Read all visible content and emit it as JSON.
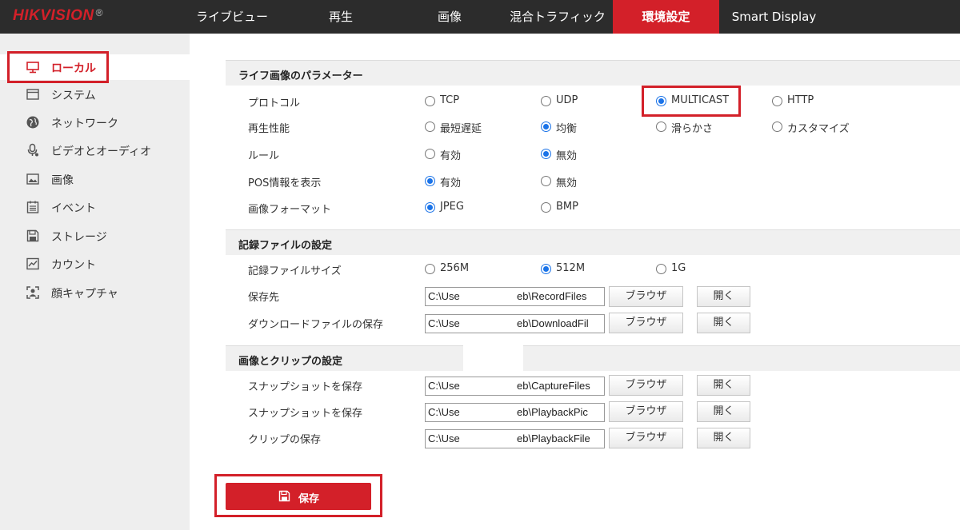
{
  "brand": {
    "name": "HIKVISION",
    "mark": "®",
    "accent": "#d32029"
  },
  "nav": {
    "tabs": [
      {
        "label": "ライブビュー",
        "active": false
      },
      {
        "label": "再生",
        "active": false
      },
      {
        "label": "画像",
        "active": false
      },
      {
        "label": "混合トラフィック",
        "active": false
      },
      {
        "label": "環境設定",
        "active": true
      },
      {
        "label": "Smart Display",
        "active": false
      }
    ]
  },
  "sidebar": {
    "items": [
      {
        "label": "ローカル",
        "icon": "monitor-icon",
        "active": true
      },
      {
        "label": "システム",
        "icon": "system-icon",
        "active": false
      },
      {
        "label": "ネットワーク",
        "icon": "globe-icon",
        "active": false
      },
      {
        "label": "ビデオとオーディオ",
        "icon": "microphone-icon",
        "active": false
      },
      {
        "label": "画像",
        "icon": "image-icon",
        "active": false
      },
      {
        "label": "イベント",
        "icon": "calendar-icon",
        "active": false
      },
      {
        "label": "ストレージ",
        "icon": "floppy-icon",
        "active": false
      },
      {
        "label": "カウント",
        "icon": "chart-icon",
        "active": false
      },
      {
        "label": "顔キャプチャ",
        "icon": "face-capture-icon",
        "active": false
      }
    ]
  },
  "live": {
    "title": "ライフ画像のパラメーター",
    "protocol": {
      "label": "プロトコル",
      "options": [
        "TCP",
        "UDP",
        "MULTICAST",
        "HTTP"
      ],
      "selected": "MULTICAST"
    },
    "performance": {
      "label": "再生性能",
      "options": [
        "最短遅延",
        "均衡",
        "滑らかさ",
        "カスタマイズ"
      ],
      "selected": "均衡"
    },
    "rule": {
      "label": "ルール",
      "options": [
        "有効",
        "無効"
      ],
      "selected": "無効"
    },
    "pos": {
      "label": "POS情報を表示",
      "options": [
        "有効",
        "無効"
      ],
      "selected": "有効"
    },
    "format": {
      "label": "画像フォーマット",
      "options": [
        "JPEG",
        "BMP"
      ],
      "selected": "JPEG"
    }
  },
  "record": {
    "title": "記録ファイルの設定",
    "size": {
      "label": "記録ファイルサイズ",
      "options": [
        "256M",
        "512M",
        "1G"
      ],
      "selected": "512M"
    },
    "paths": [
      {
        "label": "保存先",
        "value_start": "C:\\Use",
        "value_end": "eb\\RecordFiles"
      },
      {
        "label": "ダウンロードファイルの保存",
        "value_start": "C:\\Use",
        "value_end": "eb\\DownloadFil"
      }
    ]
  },
  "clip": {
    "title": "画像とクリップの設定",
    "paths": [
      {
        "label": "スナップショットを保存",
        "value_start": "C:\\Use",
        "value_end": "eb\\CaptureFiles"
      },
      {
        "label": "スナップショットを保存",
        "value_start": "C:\\Use",
        "value_end": "eb\\PlaybackPic"
      },
      {
        "label": "クリップの保存",
        "value_start": "C:\\Use",
        "value_end": "eb\\PlaybackFile"
      }
    ]
  },
  "buttons": {
    "browse": "ブラウザ",
    "open": "開く",
    "save": "保存"
  }
}
